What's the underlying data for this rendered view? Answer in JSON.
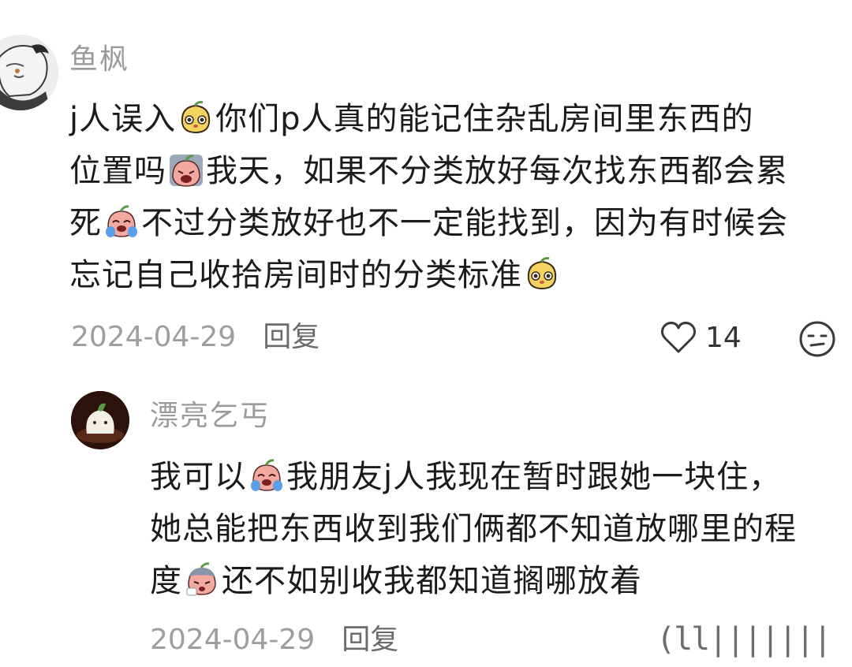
{
  "comments": [
    {
      "username": "鱼枫",
      "lines": [
        [
          "j人误入",
          "你们p人真的能记住杂乱房间里东西的"
        ],
        [
          "位置吗",
          "我天，如果不分类放好每次找东西都会累"
        ],
        [
          "死",
          "不过分类放好也不一定能找到，因为有时候会"
        ],
        [
          "忘记自己收拾房间时的分类标准",
          ""
        ]
      ],
      "date": "2024-04-29",
      "reply_label": "回复",
      "like_count": "14"
    },
    {
      "username": "漂亮乞丐",
      "lines": [
        [
          "我可以",
          "我朋友j人我现在暂时跟她一块住，"
        ],
        [
          "她总能把东西收到我们俩都不知道放哪里的程",
          ""
        ],
        [
          "度",
          "还不如别收我都知道搁哪放着"
        ]
      ],
      "date": "2024-04-29",
      "reply_label": "回复"
    }
  ],
  "watermark": "(ll|||||||",
  "icons": {
    "like": "heart-outline-icon",
    "dislike": "meh-face-icon",
    "emoji_yellow": "yellow-blob-emoji-icon",
    "emoji_pink_sad": "pink-sad-emoji-icon",
    "emoji_pink_cry": "pink-crying-emoji-icon",
    "emoji_pink_sweat": "pink-sweat-emoji-icon"
  }
}
